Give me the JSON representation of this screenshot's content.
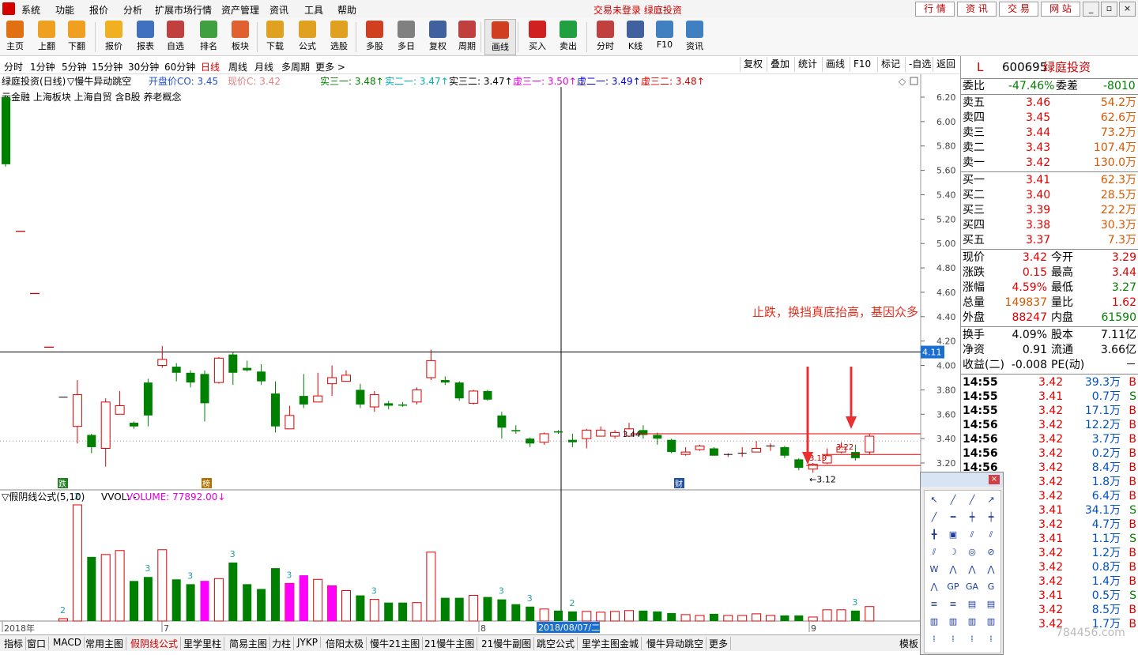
{
  "menu": {
    "items": [
      "系统",
      "功能",
      "报价",
      "分析",
      "扩展市场行情",
      "资产管理",
      "资讯",
      "工具",
      "帮助"
    ],
    "status_text": "交易未登录  绿庭投资",
    "right_tabs": [
      "行 情",
      "资 讯",
      "交 易",
      "网 站"
    ],
    "window_buttons": [
      "_",
      "▫",
      "×"
    ]
  },
  "toolbar": {
    "buttons": [
      {
        "label": "主页",
        "icon": "home-icon",
        "color": "#e07010"
      },
      {
        "label": "上翻",
        "icon": "arrow-up-icon",
        "color": "#f0a020"
      },
      {
        "label": "下翻",
        "icon": "arrow-down-icon",
        "color": "#f0a020"
      },
      {
        "label": "报价",
        "icon": "yen-icon",
        "color": "#f0b020"
      },
      {
        "label": "报表",
        "icon": "report-icon",
        "color": "#4070c0"
      },
      {
        "label": "自选",
        "icon": "f6-icon",
        "color": "#c04040"
      },
      {
        "label": "排名",
        "icon": "ranking-icon",
        "color": "#40a040"
      },
      {
        "label": "板块",
        "icon": "sector-icon",
        "color": "#e06030"
      },
      {
        "label": "下载",
        "icon": "download-icon",
        "color": "#e0a020"
      },
      {
        "label": "公式",
        "icon": "formula-icon",
        "color": "#e0a020"
      },
      {
        "label": "选股",
        "icon": "stock-pick-icon",
        "color": "#e0a020"
      },
      {
        "label": "多股",
        "icon": "multi-stock-icon",
        "color": "#d04020"
      },
      {
        "label": "多日",
        "icon": "clock-icon",
        "color": "#808080"
      },
      {
        "label": "复权",
        "icon": "adjust-icon",
        "color": "#4060a0"
      },
      {
        "label": "周期",
        "icon": "f8-icon",
        "color": "#c04040"
      },
      {
        "label": "画线",
        "icon": "pencil-icon",
        "color": "#d04020"
      },
      {
        "label": "买入",
        "icon": "buy-icon",
        "color": "#d02020"
      },
      {
        "label": "卖出",
        "icon": "sell-icon",
        "color": "#20a040"
      },
      {
        "label": "分时",
        "icon": "intraday-icon",
        "color": "#c04040"
      },
      {
        "label": "K线",
        "icon": "kline-icon",
        "color": "#4060a0"
      },
      {
        "label": "F10",
        "icon": "f10-icon",
        "color": "#4080c0"
      },
      {
        "label": "资讯",
        "icon": "news-icon",
        "color": "#4080c0"
      }
    ]
  },
  "periods": [
    "分时",
    "1分钟",
    "5分钟",
    "15分钟",
    "30分钟",
    "60分钟",
    "日线",
    "周线",
    "月线",
    "多周期",
    "更多 >"
  ],
  "active_period": "日线",
  "period_right": [
    "复权",
    "叠加",
    "统计",
    "画线",
    "F10",
    "标记",
    "-自选",
    "返回"
  ],
  "chart": {
    "header": {
      "name": "绿庭投资(日线)",
      "formula": "▽慢牛异动跳空",
      "open_label": "开盘价CO: 3.45",
      "now_label": "现价C: 3.42",
      "items": [
        {
          "text": "实三一: 3.48",
          "color": "#008000"
        },
        {
          "text": "实二一: 3.47",
          "color": "#00b0b0"
        },
        {
          "text": "实三二: 3.47",
          "color": "#000000"
        },
        {
          "text": "虚三一: 3.50",
          "color": "#e000e0"
        },
        {
          "text": "虚二一: 3.49",
          "color": "#0000e0"
        },
        {
          "text": "虚三二: 3.48",
          "color": "#e00000"
        }
      ]
    },
    "concepts": "元金融  上海板块  上海自贸 含B股 养老概念",
    "annotation": "止跌，换挡真底抬高，基因众多",
    "price_ticks": [
      "6.20",
      "6.00",
      "5.80",
      "5.60",
      "5.40",
      "5.20",
      "5.00",
      "4.80",
      "4.60",
      "4.40",
      "4.20",
      "4.00",
      "3.80",
      "3.60",
      "3.40",
      "3.20"
    ],
    "crosshair_value": "4.11",
    "labels": {
      "low_label": "3.12",
      "p319": "3.19",
      "p344": "3.44",
      "p322": "3.22"
    },
    "event_tags": [
      "跌",
      "榜",
      "财"
    ],
    "volume_header": {
      "title": "▽假阴线公式(5,10)",
      "vvol": "VVOL: -",
      "volume": "VOLUME: 77892.00"
    },
    "date_ticks": [
      "2018年",
      "7",
      "8",
      "9"
    ],
    "cursor_date": "2018/08/07/二"
  },
  "chart_data": {
    "type": "candlestick",
    "candles": [
      {
        "o": 3.74,
        "c": 3.74,
        "h": 3.74,
        "l": 3.74,
        "v": 300
      },
      {
        "o": 3.5,
        "c": 3.76,
        "h": 3.88,
        "l": 3.36,
        "v": 14500
      },
      {
        "o": 3.43,
        "c": 3.33,
        "h": 3.44,
        "l": 3.28,
        "v": 8000
      },
      {
        "o": 3.32,
        "c": 3.7,
        "h": 3.73,
        "l": 3.17,
        "v": 8300
      },
      {
        "o": 3.6,
        "c": 3.67,
        "h": 3.79,
        "l": 3.61,
        "v": 8800
      },
      {
        "o": 3.53,
        "c": 3.5,
        "h": 3.54,
        "l": 3.48,
        "v": 5000
      },
      {
        "o": 3.86,
        "c": 3.59,
        "h": 3.89,
        "l": 3.5,
        "v": 5500
      },
      {
        "o": 4.0,
        "c": 4.05,
        "h": 4.16,
        "l": 3.98,
        "v": 8900
      },
      {
        "o": 3.99,
        "c": 3.94,
        "h": 4.02,
        "l": 3.87,
        "v": 5200
      },
      {
        "o": 3.94,
        "c": 3.86,
        "h": 3.96,
        "l": 3.82,
        "v": 4600
      },
      {
        "o": 3.93,
        "c": 3.69,
        "h": 3.96,
        "l": 3.54,
        "v": 5000
      },
      {
        "o": 3.86,
        "c": 4.06,
        "h": 4.07,
        "l": 3.85,
        "v": 5300
      },
      {
        "o": 4.09,
        "c": 3.94,
        "h": 4.11,
        "l": 3.84,
        "v": 7300
      },
      {
        "o": 3.98,
        "c": 3.96,
        "h": 4.04,
        "l": 3.95,
        "v": 4600
      },
      {
        "o": 3.95,
        "c": 3.87,
        "h": 4.01,
        "l": 3.84,
        "v": 4000
      },
      {
        "o": 3.77,
        "c": 3.5,
        "h": 3.87,
        "l": 3.45,
        "v": 6600
      },
      {
        "o": 3.48,
        "c": 3.59,
        "h": 3.67,
        "l": 3.48,
        "v": 4700
      },
      {
        "o": 3.75,
        "c": 3.68,
        "h": 3.93,
        "l": 3.65,
        "v": 5700
      },
      {
        "o": 3.7,
        "c": 3.75,
        "h": 3.94,
        "l": 3.74,
        "v": 5200
      },
      {
        "o": 3.85,
        "c": 3.9,
        "h": 4.0,
        "l": 3.75,
        "v": 4400
      },
      {
        "o": 3.87,
        "c": 3.92,
        "h": 3.96,
        "l": 3.87,
        "v": 3800
      },
      {
        "o": 3.8,
        "c": 3.68,
        "h": 3.85,
        "l": 3.65,
        "v": 3200
      },
      {
        "o": 3.66,
        "c": 3.76,
        "h": 3.79,
        "l": 3.62,
        "v": 2700
      },
      {
        "o": 3.69,
        "c": 3.67,
        "h": 3.71,
        "l": 3.64,
        "v": 2300
      },
      {
        "o": 3.68,
        "c": 3.67,
        "h": 3.7,
        "l": 3.66,
        "v": 2300
      },
      {
        "o": 3.7,
        "c": 3.8,
        "h": 3.82,
        "l": 3.68,
        "v": 2300
      },
      {
        "o": 3.9,
        "c": 4.04,
        "h": 4.13,
        "l": 3.88,
        "v": 8600
      },
      {
        "o": 3.88,
        "c": 3.86,
        "h": 3.91,
        "l": 3.84,
        "v": 2900
      },
      {
        "o": 3.86,
        "c": 3.73,
        "h": 3.87,
        "l": 3.71,
        "v": 2900
      },
      {
        "o": 3.69,
        "c": 3.79,
        "h": 3.8,
        "l": 3.68,
        "v": 3200
      },
      {
        "o": 3.79,
        "c": 3.72,
        "h": 3.8,
        "l": 3.71,
        "v": 3000
      },
      {
        "o": 3.59,
        "c": 3.49,
        "h": 3.62,
        "l": 3.4,
        "v": 2700
      },
      {
        "o": 3.47,
        "c": 3.46,
        "h": 3.51,
        "l": 3.44,
        "v": 2100
      },
      {
        "o": 3.4,
        "c": 3.36,
        "h": 3.41,
        "l": 3.33,
        "v": 1800
      },
      {
        "o": 3.37,
        "c": 3.44,
        "h": 3.45,
        "l": 3.35,
        "v": 1500
      },
      {
        "o": 3.46,
        "c": 3.45,
        "h": 3.47,
        "l": 3.44,
        "v": 1300
      },
      {
        "o": 3.39,
        "c": 3.37,
        "h": 3.44,
        "l": 3.33,
        "v": 1200
      },
      {
        "o": 3.4,
        "c": 3.47,
        "h": 3.48,
        "l": 3.32,
        "v": 1200
      },
      {
        "o": 3.42,
        "c": 3.47,
        "h": 3.5,
        "l": 3.42,
        "v": 1100
      },
      {
        "o": 3.42,
        "c": 3.45,
        "h": 3.47,
        "l": 3.4,
        "v": 1200
      },
      {
        "o": 3.42,
        "c": 3.48,
        "h": 3.53,
        "l": 3.42,
        "v": 1300
      },
      {
        "o": 3.47,
        "c": 3.43,
        "h": 3.51,
        "l": 3.4,
        "v": 1300
      },
      {
        "o": 3.43,
        "c": 3.4,
        "h": 3.45,
        "l": 3.35,
        "v": 1200
      },
      {
        "o": 3.39,
        "c": 3.29,
        "h": 3.4,
        "l": 3.28,
        "v": 1000
      },
      {
        "o": 3.27,
        "c": 3.29,
        "h": 3.33,
        "l": 3.26,
        "v": 800
      },
      {
        "o": 3.31,
        "c": 3.34,
        "h": 3.35,
        "l": 3.3,
        "v": 700
      },
      {
        "o": 3.32,
        "c": 3.26,
        "h": 3.33,
        "l": 3.26,
        "v": 900
      },
      {
        "o": 3.27,
        "c": 3.27,
        "h": 3.28,
        "l": 3.25,
        "v": 700
      },
      {
        "o": 3.28,
        "c": 3.28,
        "h": 3.33,
        "l": 3.25,
        "v": 700
      },
      {
        "o": 3.29,
        "c": 3.32,
        "h": 3.38,
        "l": 3.29,
        "v": 900
      },
      {
        "o": 3.34,
        "c": 3.34,
        "h": 3.36,
        "l": 3.3,
        "v": 700
      },
      {
        "o": 3.33,
        "c": 3.26,
        "h": 3.34,
        "l": 3.24,
        "v": 700
      },
      {
        "o": 3.23,
        "c": 3.16,
        "h": 3.24,
        "l": 3.14,
        "v": 700
      },
      {
        "o": 3.15,
        "c": 3.19,
        "h": 3.2,
        "l": 3.12,
        "v": 500
      },
      {
        "o": 3.2,
        "c": 3.26,
        "h": 3.32,
        "l": 3.19,
        "v": 1400
      },
      {
        "o": 3.29,
        "c": 3.33,
        "h": 3.37,
        "l": 3.28,
        "v": 1400
      },
      {
        "o": 3.29,
        "c": 3.24,
        "h": 3.35,
        "l": 3.22,
        "v": 1300
      },
      {
        "o": 3.29,
        "c": 3.42,
        "h": 3.44,
        "l": 3.27,
        "v": 1800
      }
    ],
    "special_candles": {
      "magenta": [
        20
      ],
      "first_bar_price": [
        6.2,
        5.65
      ],
      "isolated_marks": [
        [
          5.1,
          1
        ],
        [
          4.59,
          2
        ],
        [
          4.15,
          3
        ]
      ]
    },
    "volume_labels": [
      {
        "i": 0,
        "t": "2"
      },
      {
        "i": 1,
        "t": "2"
      },
      {
        "i": 6,
        "t": "3"
      },
      {
        "i": 9,
        "t": "3"
      },
      {
        "i": 12,
        "t": "3"
      },
      {
        "i": 16,
        "t": "3"
      },
      {
        "i": 22,
        "t": "3"
      },
      {
        "i": 31,
        "t": "3"
      },
      {
        "i": 33,
        "t": "3"
      },
      {
        "i": 36,
        "t": "2"
      },
      {
        "i": 56,
        "t": "3"
      }
    ],
    "ylim": [
      3.1,
      6.3
    ]
  },
  "quote": {
    "code": "600695",
    "name": "绿庭投资",
    "weibi_label": "委比",
    "weibi": "-47.46%",
    "weicha_label": "委差",
    "weicha": "-8010",
    "asks": [
      {
        "label": "卖五",
        "price": "3.46",
        "vol": "54.2万"
      },
      {
        "label": "卖四",
        "price": "3.45",
        "vol": "62.6万"
      },
      {
        "label": "卖三",
        "price": "3.44",
        "vol": "73.2万"
      },
      {
        "label": "卖二",
        "price": "3.43",
        "vol": "107.4万"
      },
      {
        "label": "卖一",
        "price": "3.42",
        "vol": "130.0万"
      }
    ],
    "bids": [
      {
        "label": "买一",
        "price": "3.41",
        "vol": "62.3万"
      },
      {
        "label": "买二",
        "price": "3.40",
        "vol": "28.5万"
      },
      {
        "label": "买三",
        "price": "3.39",
        "vol": "22.2万"
      },
      {
        "label": "买四",
        "price": "3.38",
        "vol": "30.3万"
      },
      {
        "label": "买五",
        "price": "3.37",
        "vol": "7.3万"
      }
    ],
    "stats": [
      [
        "现价",
        "3.42",
        "今开",
        "3.29"
      ],
      [
        "涨跌",
        "0.15",
        "最高",
        "3.44"
      ],
      [
        "涨幅",
        "4.59%",
        "最低",
        "3.27"
      ],
      [
        "总量",
        "149837",
        "量比",
        "1.62"
      ],
      [
        "外盘",
        "88247",
        "内盘",
        "61590"
      ]
    ],
    "fund": [
      [
        "换手",
        "4.09%",
        "股本",
        "7.11亿"
      ],
      [
        "净资",
        "0.91",
        "流通",
        "3.66亿"
      ],
      [
        "收益(二)",
        "-0.008",
        "PE(动)",
        "－"
      ]
    ],
    "ticks": [
      [
        "14:55",
        "3.42",
        "39.3万",
        "B"
      ],
      [
        "14:55",
        "3.41",
        "0.7万",
        "S"
      ],
      [
        "14:55",
        "3.42",
        "17.1万",
        "B"
      ],
      [
        "14:56",
        "3.42",
        "12.2万",
        "B"
      ],
      [
        "14:56",
        "3.42",
        "3.7万",
        "B"
      ],
      [
        "14:56",
        "3.42",
        "0.2万",
        "B"
      ],
      [
        "14:56",
        "3.42",
        "8.4万",
        "B"
      ],
      [
        "14:56",
        "3.42",
        "1.8万",
        "B"
      ],
      [
        "14:56",
        "3.42",
        "6.4万",
        "B"
      ],
      [
        "14:56",
        "3.41",
        "34.1万",
        "S"
      ],
      [
        "14:56",
        "3.42",
        "4.7万",
        "B"
      ],
      [
        "14:56",
        "3.41",
        "1.1万",
        "S"
      ],
      [
        "14:56",
        "3.42",
        "1.2万",
        "B"
      ],
      [
        "14:57",
        "3.42",
        "0.8万",
        "B"
      ],
      [
        "14:57",
        "3.42",
        "1.4万",
        "B"
      ],
      [
        "14:57",
        "3.41",
        "0.5万",
        "S"
      ],
      [
        "14:57",
        "3.42",
        "8.5万",
        "B"
      ],
      [
        "14:57",
        "3.42",
        "1.7万",
        "B"
      ]
    ]
  },
  "bottom_tabs": [
    "指标",
    "窗口",
    "MACD",
    "常用主图",
    "假阴线公式",
    "里学里柱",
    "简易主图",
    "力柱",
    "JYKP",
    "倍阳太极",
    "慢牛21主图",
    "21慢牛主图",
    "21慢牛副图",
    "跳空公式",
    "里学主图金城",
    "慢牛异动跳空",
    "更多",
    "模板"
  ],
  "active_bottom_tab": "假阴线公式",
  "palette_icons": [
    "↖",
    "╱",
    "╱",
    "↗",
    "╱",
    "━",
    "┿",
    "┿",
    "╋",
    "▣",
    "⫽",
    "⫽",
    "⫽",
    "☽",
    "◎",
    "⊘",
    "W",
    "⋀",
    "⋀",
    "⋀",
    "⋀",
    "GP",
    "GA",
    "G",
    "≡",
    "≡",
    "▤",
    "▤",
    "▥",
    "▥",
    "▥",
    "▥",
    "⁞",
    "⁞",
    "⁞",
    "⁞"
  ],
  "watermark": "784456.com"
}
